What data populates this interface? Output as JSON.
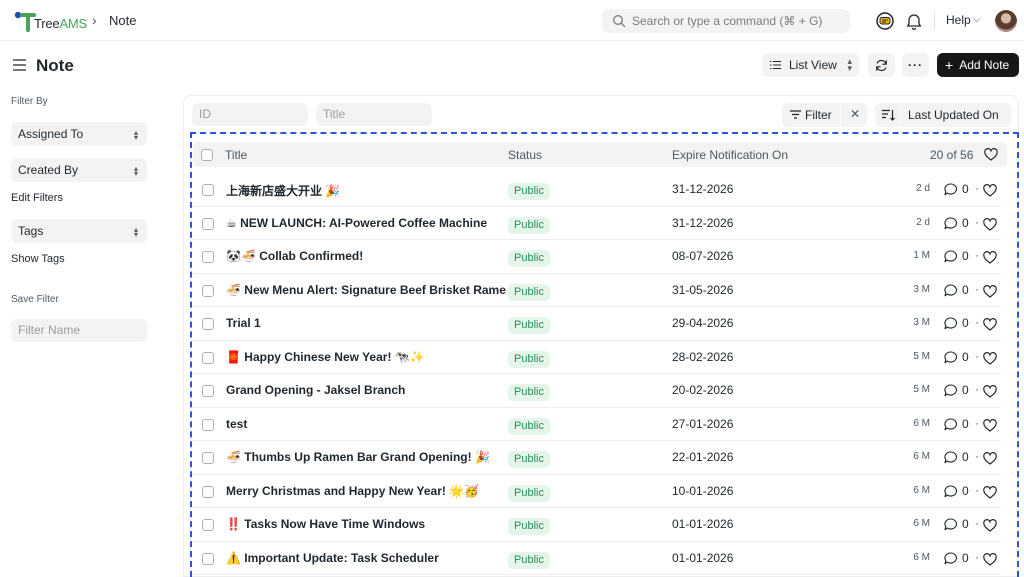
{
  "app": {
    "logo_text_main": "Tree",
    "logo_text_accent": "AMS",
    "breadcrumb": "Note",
    "search_placeholder": "Search or type a command (⌘ + G)",
    "help_label": "Help"
  },
  "header": {
    "title": "Note",
    "list_view_label": "List View",
    "add_label": "Add Note",
    "more_label": "···"
  },
  "sidebar": {
    "filter_by_label": "Filter By",
    "assigned_to": "Assigned To",
    "created_by": "Created By",
    "edit_filters": "Edit Filters",
    "tags": "Tags",
    "show_tags": "Show Tags",
    "save_filter_label": "Save Filter",
    "filter_name_placeholder": "Filter Name"
  },
  "filters": {
    "id_placeholder": "ID",
    "title_placeholder": "Title",
    "filter_label": "Filter",
    "sort_label": "Last Updated On"
  },
  "table": {
    "columns": {
      "title": "Title",
      "status": "Status",
      "expire": "Expire Notification On"
    },
    "count": "20 of 56",
    "rows": [
      {
        "title": "上海新店盛大开业 🎉",
        "status": "Public",
        "date": "31-12-2026",
        "age": "2 d",
        "comments": "0"
      },
      {
        "title": "☕ NEW LAUNCH: AI-Powered Coffee Machine",
        "status": "Public",
        "date": "31-12-2026",
        "age": "2 d",
        "comments": "0"
      },
      {
        "title": "🐼🍜 Collab Confirmed!",
        "status": "Public",
        "date": "08-07-2026",
        "age": "1 M",
        "comments": "0"
      },
      {
        "title": "🍜 New Menu Alert: Signature Beef Brisket Rame",
        "status": "Public",
        "date": "31-05-2026",
        "age": "3 M",
        "comments": "0"
      },
      {
        "title": "Trial 1",
        "status": "Public",
        "date": "29-04-2026",
        "age": "3 M",
        "comments": "0"
      },
      {
        "title": "🧧 Happy Chinese New Year! 🐄✨",
        "status": "Public",
        "date": "28-02-2026",
        "age": "5 M",
        "comments": "0"
      },
      {
        "title": "Grand Opening - Jaksel Branch",
        "status": "Public",
        "date": "20-02-2026",
        "age": "5 M",
        "comments": "0"
      },
      {
        "title": "test",
        "status": "Public",
        "date": "27-01-2026",
        "age": "6 M",
        "comments": "0"
      },
      {
        "title": "🍜 Thumbs Up Ramen Bar Grand Opening! 🎉",
        "status": "Public",
        "date": "22-01-2026",
        "age": "6 M",
        "comments": "0"
      },
      {
        "title": "Merry Christmas and Happy New Year! 🌟🥳",
        "status": "Public",
        "date": "10-01-2026",
        "age": "6 M",
        "comments": "0"
      },
      {
        "title": "‼️ Tasks Now Have Time Windows",
        "status": "Public",
        "date": "01-01-2026",
        "age": "6 M",
        "comments": "0"
      },
      {
        "title": "⚠️ Important Update: Task Scheduler",
        "status": "Public",
        "date": "01-01-2026",
        "age": "6 M",
        "comments": "0"
      }
    ]
  },
  "colors": {
    "accent_dark": "#171717",
    "badge_bg": "#e4f5e9",
    "badge_text": "#278f5e",
    "selection_dash": "#2f55e0",
    "logo_green": "#4aa35a"
  }
}
